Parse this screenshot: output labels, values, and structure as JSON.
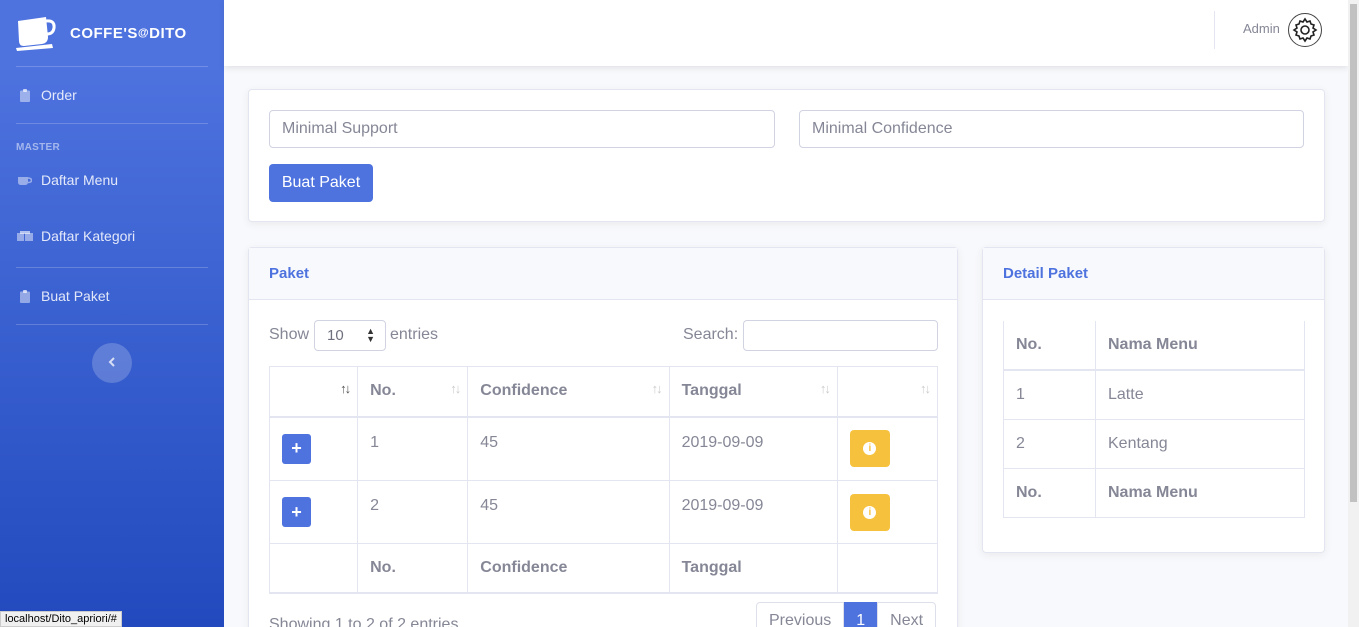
{
  "brand": {
    "name": "COFFE'S",
    "at": "@",
    "suffix": "DITO",
    "icon": "coffee-cup-icon"
  },
  "sidebar": {
    "order_label": "Order",
    "heading": "MASTER",
    "items": [
      {
        "label": "Daftar Menu",
        "icon": "coffee-icon"
      },
      {
        "label": "Daftar Kategori",
        "icon": "boxes-icon"
      },
      {
        "label": "Buat Paket",
        "icon": "clipboard-icon"
      }
    ],
    "toggle_icon": "chevron-left-icon"
  },
  "topbar": {
    "user_name": "Admin",
    "avatar_icon": "gear-icon"
  },
  "form": {
    "support_placeholder": "Minimal Support",
    "confidence_placeholder": "Minimal Confidence",
    "submit_label": "Buat Paket"
  },
  "paket": {
    "title": "Paket",
    "show_label": "Show",
    "entries_value": "10",
    "entries_label": "entries",
    "search_label": "Search:",
    "columns": [
      "No.",
      "Confidence",
      "Tanggal"
    ],
    "rows": [
      {
        "no": "1",
        "confidence": "45",
        "tanggal": "2019-09-09"
      },
      {
        "no": "2",
        "confidence": "45",
        "tanggal": "2019-09-09"
      }
    ],
    "info_text": "Showing 1 to 2 of 2 entries",
    "pagination": {
      "previous": "Previous",
      "current": "1",
      "next": "Next"
    }
  },
  "detail": {
    "title": "Detail Paket",
    "columns": [
      "No.",
      "Nama Menu"
    ],
    "rows": [
      {
        "no": "1",
        "menu": "Latte"
      },
      {
        "no": "2",
        "menu": "Kentang"
      }
    ]
  },
  "statusbar": {
    "url": "localhost/Dito_apriori/#"
  },
  "colors": {
    "primary": "#4e73df",
    "warning": "#f6c23e",
    "text": "#858796"
  }
}
